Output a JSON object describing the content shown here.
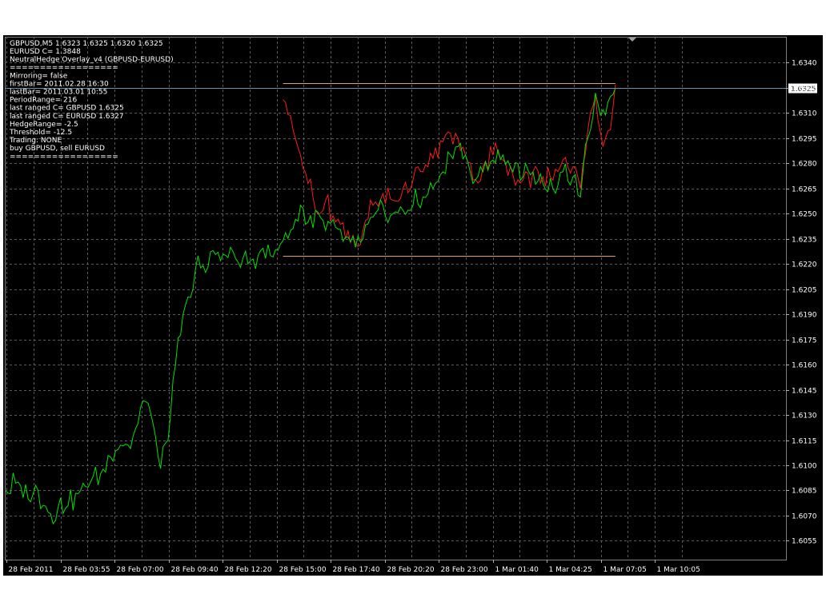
{
  "window": {
    "header_line": "GBPUSD,M5  1.6323 1.6325 1.6320 1.6325"
  },
  "info_lines": [
    "EURUSD C= 1.3848",
    "NeutralHedge Overlay_v4 (GBPUSD-EURUSD)",
    "==================",
    "Mirroring= false",
    "firstBar= 2011.02.28 16:30",
    "lastBar= 2011.03.01 10:55",
    "PeriodRange= 216",
    "last ranged C= GBPUSD 1.6325",
    "last ranged C= EURUSD 1.6327",
    "HedgeRange= -2.5",
    "Threshold= -12.5",
    "Trading: NONE",
    "buy GBPUSD, sell EURUSD",
    "=================="
  ],
  "colors": {
    "background": "#000000",
    "grid": "#5a5a5a",
    "gbpusd_line": "#00e000",
    "eurusd_line": "#ff1a1a",
    "range_line": "#e8a050",
    "price_line": "#6f8fa8",
    "text": "#ffffff"
  },
  "chart_data": {
    "type": "line",
    "symbol": "GBPUSD",
    "timeframe": "M5",
    "ylim": [
      1.6049,
      1.6345
    ],
    "y_ticks": [
      "1.6340",
      "1.6325",
      "1.6310",
      "1.6295",
      "1.6280",
      "1.6265",
      "1.6250",
      "1.6235",
      "1.6220",
      "1.6205",
      "1.6190",
      "1.6175",
      "1.6160",
      "1.6145",
      "1.6130",
      "1.6115",
      "1.6100",
      "1.6085",
      "1.6070",
      "1.6055"
    ],
    "x_ticks": [
      "28 Feb 2011",
      "28 Feb 03:55",
      "28 Feb 07:00",
      "28 Feb 09:40",
      "28 Feb 12:20",
      "28 Feb 15:00",
      "28 Feb 17:40",
      "28 Feb 20:20",
      "28 Feb 23:00",
      "1 Mar 01:40",
      "1 Mar 04:25",
      "1 Mar 07:05",
      "1 Mar 10:05"
    ],
    "current_price_label": "1.6325",
    "range_high": 1.6328,
    "range_low": 1.6225,
    "bar_count": 254,
    "range_start_bar": 111,
    "series": [
      {
        "name": "GBPUSD",
        "anchors": [
          [
            0,
            1.6085
          ],
          [
            5,
            1.609
          ],
          [
            9,
            1.608
          ],
          [
            13,
            1.6085
          ],
          [
            17,
            1.6072
          ],
          [
            21,
            1.6075
          ],
          [
            25,
            1.6076
          ],
          [
            30,
            1.6085
          ],
          [
            34,
            1.609
          ],
          [
            38,
            1.6095
          ],
          [
            42,
            1.6105
          ],
          [
            46,
            1.6112
          ],
          [
            50,
            1.611
          ],
          [
            53,
            1.6125
          ],
          [
            56,
            1.6138
          ],
          [
            59,
            1.6125
          ],
          [
            62,
            1.6098
          ],
          [
            65,
            1.6115
          ],
          [
            68,
            1.616
          ],
          [
            71,
            1.619
          ],
          [
            74,
            1.62
          ],
          [
            77,
            1.6225
          ],
          [
            80,
            1.6215
          ],
          [
            83,
            1.6228
          ],
          [
            86,
            1.6222
          ],
          [
            90,
            1.623
          ],
          [
            94,
            1.6218
          ],
          [
            98,
            1.6222
          ],
          [
            102,
            1.6228
          ],
          [
            106,
            1.6225
          ],
          [
            110,
            1.6232
          ],
          [
            114,
            1.624
          ],
          [
            118,
            1.6255
          ],
          [
            121,
            1.6245
          ],
          [
            124,
            1.6252
          ],
          [
            128,
            1.624
          ],
          [
            132,
            1.6242
          ],
          [
            136,
            1.6236
          ],
          [
            140,
            1.623
          ],
          [
            143,
            1.6235
          ],
          [
            147,
            1.6248
          ],
          [
            151,
            1.6255
          ],
          [
            155,
            1.625
          ],
          [
            159,
            1.6252
          ],
          [
            163,
            1.6255
          ],
          [
            167,
            1.626
          ],
          [
            171,
            1.6265
          ],
          [
            175,
            1.6275
          ],
          [
            178,
            1.6285
          ],
          [
            181,
            1.629
          ],
          [
            184,
            1.6285
          ],
          [
            187,
            1.6268
          ],
          [
            191,
            1.6275
          ],
          [
            195,
            1.6282
          ],
          [
            199,
            1.6285
          ],
          [
            203,
            1.6275
          ],
          [
            207,
            1.6272
          ],
          [
            211,
            1.6275
          ],
          [
            215,
            1.6268
          ],
          [
            219,
            1.6265
          ],
          [
            223,
            1.6275
          ],
          [
            227,
            1.6272
          ],
          [
            230,
            1.626
          ],
          [
            233,
            1.6295
          ],
          [
            236,
            1.6322
          ],
          [
            239,
            1.6312
          ],
          [
            242,
            1.632
          ],
          [
            244,
            1.6325
          ]
        ]
      },
      {
        "name": "EURUSD",
        "anchors": [
          [
            111,
            1.6318
          ],
          [
            115,
            1.63
          ],
          [
            118,
            1.6285
          ],
          [
            121,
            1.6268
          ],
          [
            124,
            1.6252
          ],
          [
            128,
            1.6258
          ],
          [
            132,
            1.6245
          ],
          [
            136,
            1.6235
          ],
          [
            140,
            1.6232
          ],
          [
            143,
            1.624
          ],
          [
            147,
            1.6255
          ],
          [
            151,
            1.6262
          ],
          [
            155,
            1.6258
          ],
          [
            159,
            1.6265
          ],
          [
            163,
            1.627
          ],
          [
            167,
            1.6275
          ],
          [
            171,
            1.6283
          ],
          [
            175,
            1.6293
          ],
          [
            178,
            1.6298
          ],
          [
            181,
            1.6295
          ],
          [
            184,
            1.6285
          ],
          [
            187,
            1.627
          ],
          [
            191,
            1.6278
          ],
          [
            195,
            1.6285
          ],
          [
            199,
            1.6282
          ],
          [
            203,
            1.6273
          ],
          [
            207,
            1.627
          ],
          [
            211,
            1.6275
          ],
          [
            215,
            1.6272
          ],
          [
            219,
            1.627
          ],
          [
            223,
            1.6282
          ],
          [
            227,
            1.6278
          ],
          [
            230,
            1.6265
          ],
          [
            233,
            1.63
          ],
          [
            236,
            1.632
          ],
          [
            239,
            1.629
          ],
          [
            242,
            1.63
          ],
          [
            244,
            1.6327
          ]
        ]
      }
    ]
  }
}
